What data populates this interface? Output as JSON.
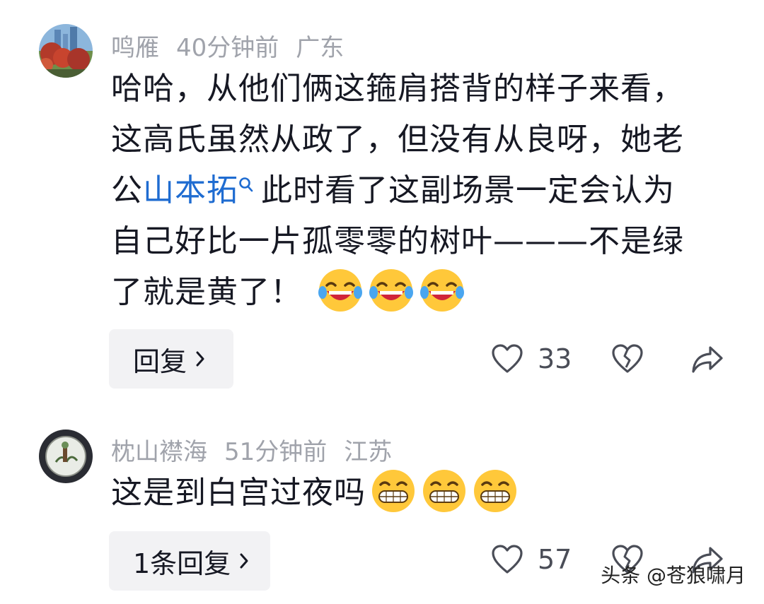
{
  "comments": [
    {
      "username": "鸣雁",
      "time": "40分钟前",
      "location": "广东",
      "text_before_link": "哈哈，从他们俩这箍肩搭背的样子来看，这高氏虽然从政了，但没有从良呀，她老公",
      "link_text": "山本拓",
      "text_after_link": "此时看了这副场景一定会认为自己好比一片孤零零的树叶———不是绿了就是黄了！",
      "emoji": [
        "laugh-cry",
        "laugh-cry",
        "laugh-cry"
      ],
      "reply_label": "回复",
      "likes": "33"
    },
    {
      "username": "枕山襟海",
      "time": "51分钟前",
      "location": "江苏",
      "text": "这是到白宫过夜吗",
      "emoji": [
        "grin",
        "grin",
        "grin"
      ],
      "reply_label": "1条回复",
      "likes": "57"
    }
  ],
  "watermark": "头条 @苍狼啸月",
  "icons": {
    "like": "heart-outline-icon",
    "dislike": "broken-heart-icon",
    "share": "share-arrow-icon",
    "reply_chevron": "chevron-right-icon"
  }
}
